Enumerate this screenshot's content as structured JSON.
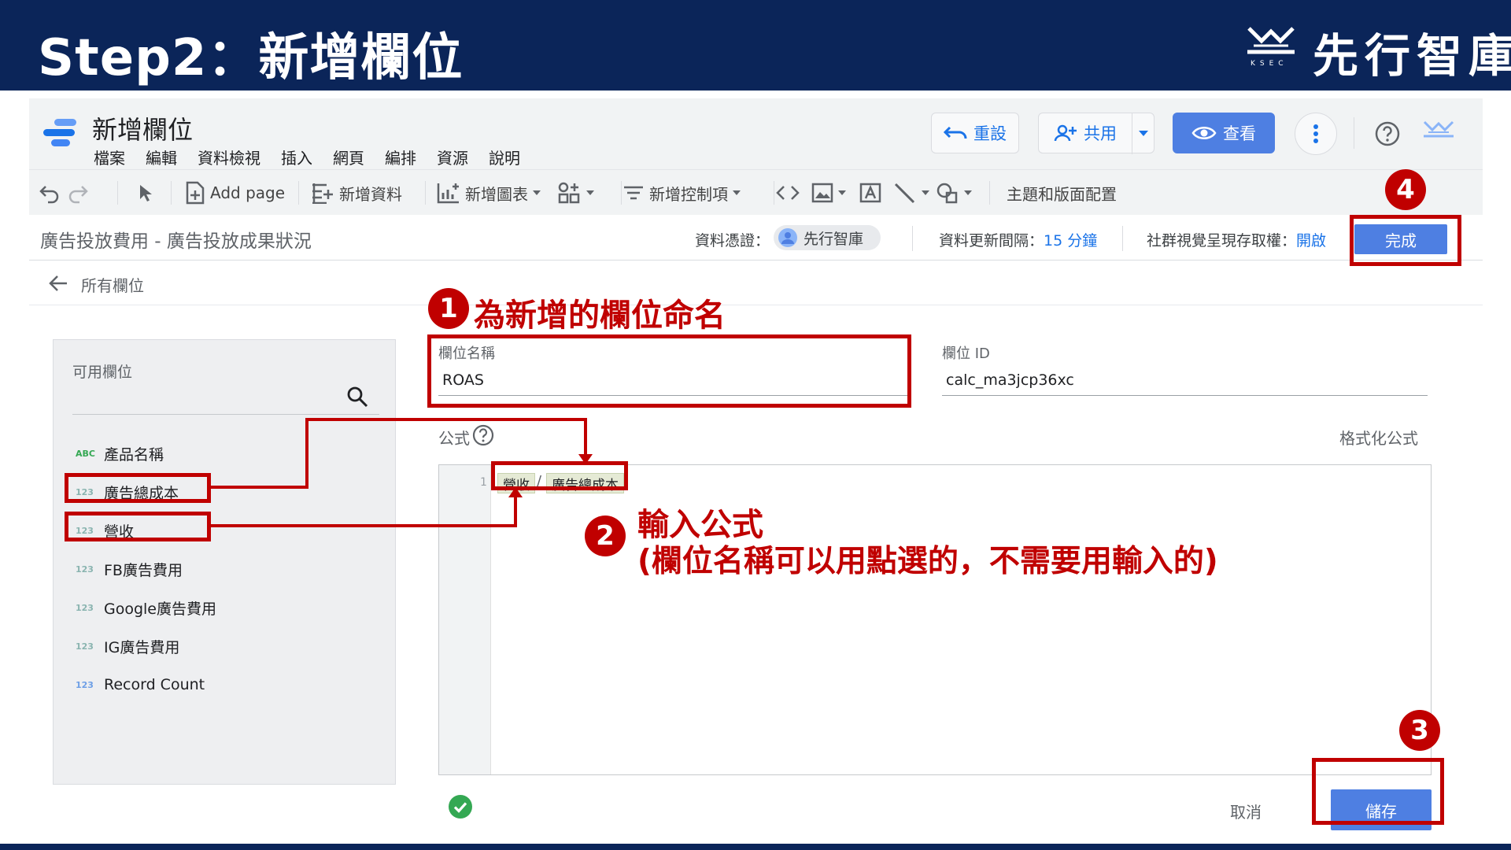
{
  "banner": {
    "title": "Step2：新增欄位",
    "brand": "先行智庫"
  },
  "app": {
    "report_title": "新增欄位",
    "menu": [
      "檔案",
      "編輯",
      "資料檢視",
      "插入",
      "網頁",
      "編排",
      "資源",
      "說明"
    ],
    "header_buttons": {
      "reset": "重設",
      "share": "共用",
      "view": "查看"
    },
    "toolbar": {
      "add_page": "Add page",
      "add_data": "新增資料",
      "add_chart": "新增圖表",
      "add_control": "新增控制項",
      "theme_layout": "主題和版面配置"
    },
    "datasource": {
      "title": "廣告投放費用 - 廣告投放成果狀況",
      "credential_label": "資料憑證：",
      "credential_value": "先行智庫",
      "refresh_label": "資料更新間隔：",
      "refresh_value": "15 分鐘",
      "viz_access_label": "社群視覺呈現存取權：",
      "viz_access_value": "開啟",
      "done": "完成"
    },
    "back_label": "所有欄位",
    "available_fields": {
      "title": "可用欄位",
      "items": [
        {
          "type": "ABC",
          "label": "產品名稱"
        },
        {
          "type": "123",
          "label": "廣告總成本"
        },
        {
          "type": "123",
          "label": "營收"
        },
        {
          "type": "123",
          "label": "FB廣告費用"
        },
        {
          "type": "123",
          "label": "Google廣告費用"
        },
        {
          "type": "123",
          "label": "IG廣告費用"
        },
        {
          "type": "123",
          "label": "Record Count"
        }
      ]
    },
    "form": {
      "name_label": "欄位名稱",
      "name_value": "ROAS",
      "id_label": "欄位 ID",
      "id_value": "calc_ma3jcp36xc",
      "formula_label": "公式",
      "format_formula": "格式化公式",
      "line_number": "1",
      "formula_tokens": [
        "營收",
        "/",
        "廣告總成本"
      ],
      "cancel": "取消",
      "save": "儲存"
    }
  },
  "annotations": {
    "step1": {
      "num": "1",
      "text": "為新增的欄位命名"
    },
    "step2": {
      "num": "2",
      "line1": "輸入公式",
      "line2": "(欄位名稱可以用點選的，不需要用輸入的)"
    },
    "step3": {
      "num": "3"
    },
    "step4": {
      "num": "4"
    }
  },
  "colors": {
    "banner": "#0b2559",
    "accent_red": "#c00000",
    "primary_blue": "#4e7fe2"
  }
}
